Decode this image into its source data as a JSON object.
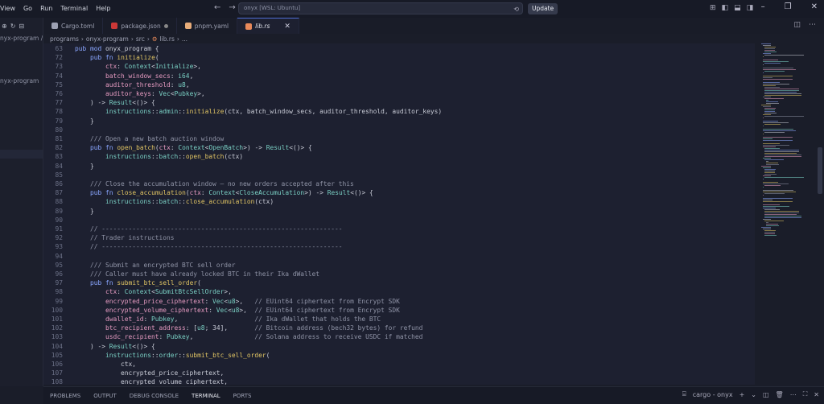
{
  "menu": [
    "View",
    "Go",
    "Run",
    "Terminal",
    "Help"
  ],
  "command_center": "onyx [WSL: Ubuntu]",
  "update_label": "Update",
  "sidebar": {
    "path": "nyx-program / s...",
    "folder": "nyx-program"
  },
  "tabs": [
    {
      "label": "Cargo.toml",
      "icon": "gear-icon",
      "color": "#9da1b3"
    },
    {
      "label": "package.json",
      "icon": "npm-icon",
      "color": "#cb3837",
      "modified": true
    },
    {
      "label": "pnpm.yaml",
      "icon": "yaml-icon",
      "color": "#e8ad7a"
    },
    {
      "label": "lib.rs",
      "icon": "rust-icon",
      "color": "#e8895a",
      "active": true
    }
  ],
  "breadcrumb": [
    "programs",
    "onyx-program",
    "src",
    "lib.rs",
    "..."
  ],
  "code_lines": [
    {
      "n": "63",
      "t": "pub mod onyx_program {"
    },
    {
      "n": "72",
      "t": "    pub fn initialize("
    },
    {
      "n": "73",
      "t": "        ctx: Context<Initialize>,"
    },
    {
      "n": "74",
      "t": "        batch_window_secs: i64,"
    },
    {
      "n": "75",
      "t": "        auditor_threshold: u8,"
    },
    {
      "n": "76",
      "t": "        auditor_keys: Vec<Pubkey>,"
    },
    {
      "n": "77",
      "t": "    ) -> Result<()> {"
    },
    {
      "n": "78",
      "t": "        instructions::admin::initialize(ctx, batch_window_secs, auditor_threshold, auditor_keys)"
    },
    {
      "n": "79",
      "t": "    }"
    },
    {
      "n": "80",
      "t": ""
    },
    {
      "n": "81",
      "t": "    /// Open a new batch auction window"
    },
    {
      "n": "82",
      "t": "    pub fn open_batch(ctx: Context<OpenBatch>) -> Result<()> {"
    },
    {
      "n": "83",
      "t": "        instructions::batch::open_batch(ctx)"
    },
    {
      "n": "84",
      "t": "    }"
    },
    {
      "n": "85",
      "t": ""
    },
    {
      "n": "86",
      "t": "    /// Close the accumulation window — no new orders accepted after this"
    },
    {
      "n": "87",
      "t": "    pub fn close_accumulation(ctx: Context<CloseAccumulation>) -> Result<()> {"
    },
    {
      "n": "88",
      "t": "        instructions::batch::close_accumulation(ctx)"
    },
    {
      "n": "89",
      "t": "    }"
    },
    {
      "n": "90",
      "t": ""
    },
    {
      "n": "91",
      "t": "    // ---------------------------------------------------------------"
    },
    {
      "n": "92",
      "t": "    // Trader instructions"
    },
    {
      "n": "93",
      "t": "    // ---------------------------------------------------------------"
    },
    {
      "n": "94",
      "t": ""
    },
    {
      "n": "95",
      "t": "    /// Submit an encrypted BTC sell order"
    },
    {
      "n": "96",
      "t": "    /// Caller must have already locked BTC in their Ika dWallet"
    },
    {
      "n": "97",
      "t": "    pub fn submit_btc_sell_order("
    },
    {
      "n": "98",
      "t": "        ctx: Context<SubmitBtcSellOrder>,"
    },
    {
      "n": "99",
      "t": "        encrypted_price_ciphertext: Vec<u8>,   // EUint64 ciphertext from Encrypt SDK"
    },
    {
      "n": "100",
      "t": "        encrypted_volume_ciphertext: Vec<u8>,  // EUint64 ciphertext from Encrypt SDK"
    },
    {
      "n": "101",
      "t": "        dwallet_id: Pubkey,                    // Ika dWallet that holds the BTC"
    },
    {
      "n": "102",
      "t": "        btc_recipient_address: [u8; 34],       // Bitcoin address (bech32 bytes) for refund"
    },
    {
      "n": "103",
      "t": "        usdc_recipient: Pubkey,                // Solana address to receive USDC if matched"
    },
    {
      "n": "104",
      "t": "    ) -> Result<()> {"
    },
    {
      "n": "105",
      "t": "        instructions::order::submit_btc_sell_order("
    },
    {
      "n": "106",
      "t": "            ctx,"
    },
    {
      "n": "107",
      "t": "            encrypted_price_ciphertext,"
    },
    {
      "n": "108",
      "t": "            encrypted_volume_ciphertext,"
    }
  ],
  "panel_tabs": [
    "PROBLEMS",
    "OUTPUT",
    "DEBUG CONSOLE",
    "TERMINAL",
    "PORTS"
  ],
  "panel_active": "TERMINAL",
  "terminal_label": "cargo - onyx"
}
